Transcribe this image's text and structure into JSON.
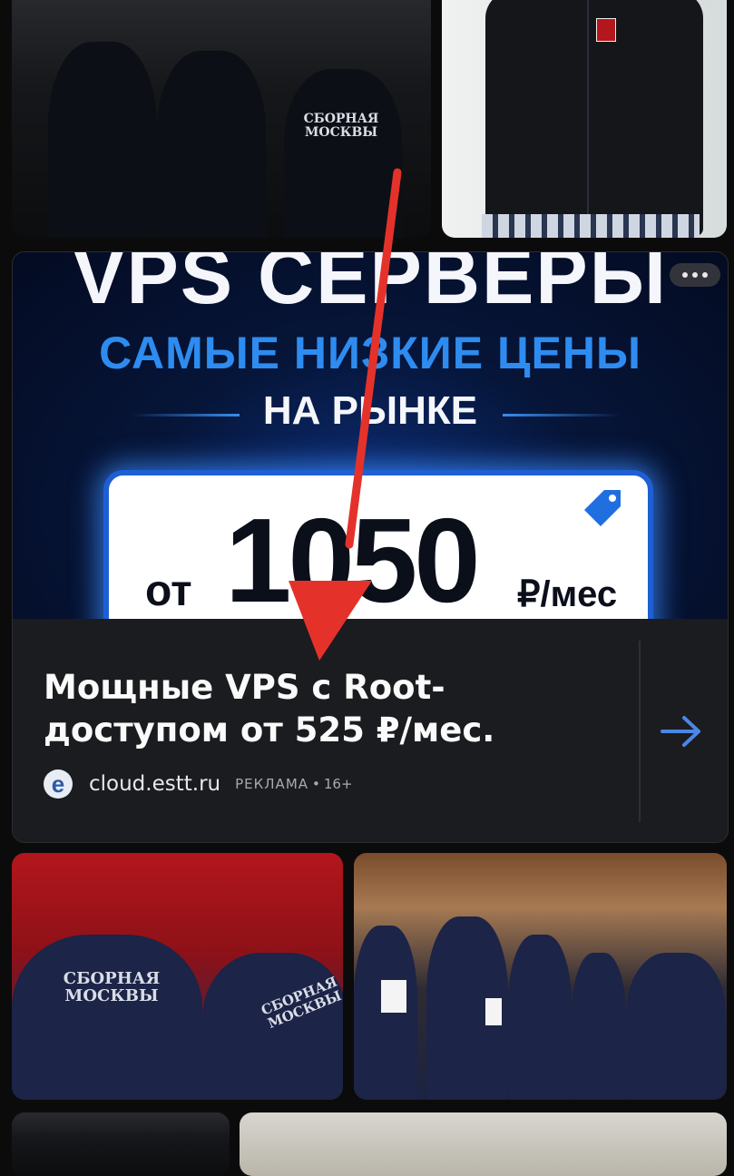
{
  "top_images": [
    {
      "alt_print": "СБОРНАЯ МОСКВЫ"
    },
    {
      "alt_print": ""
    }
  ],
  "ad": {
    "banner": {
      "line1": "VPS СЕРВЕРЫ",
      "line2": "САМЫЕ НИЗКИЕ ЦЕНЫ",
      "line3": "НА РЫНКЕ",
      "price_prefix": "от",
      "price": "1050",
      "price_unit": "₽/мес"
    },
    "headline": "Мощные VPS с Root-доступом от 525 ₽/мес.",
    "site_icon_letter": "e",
    "domain": "cloud.estt.ru",
    "ad_label": "РЕКЛАМА",
    "separator": "•",
    "age_rating": "16+"
  },
  "bottom_images": [
    {
      "print": "СБОРНАЯ МОСКВЫ"
    },
    {
      "print": "СБОРНАЯ МОСКВЫ"
    }
  ],
  "colors": {
    "banner_accent": "#2e8cf0",
    "annotation_arrow": "#e4322b",
    "ad_card_bg": "#1b1c1f"
  },
  "icons": [
    "more-dots-icon",
    "price-tag-icon",
    "site-favicon-icon",
    "arrow-right-icon"
  ]
}
